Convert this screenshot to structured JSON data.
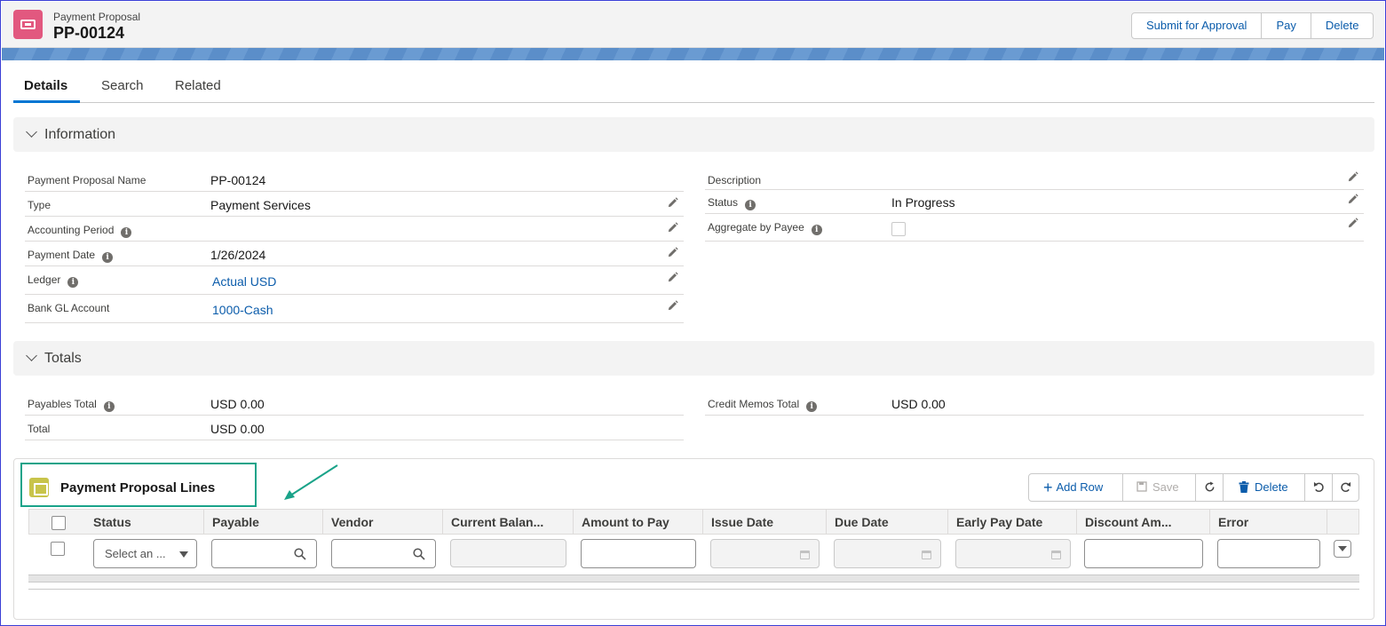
{
  "header": {
    "object_type": "Payment Proposal",
    "record_name": "PP-00124",
    "actions": [
      "Submit for Approval",
      "Pay",
      "Delete"
    ]
  },
  "tabs": [
    {
      "label": "Details",
      "active": true
    },
    {
      "label": "Search",
      "active": false
    },
    {
      "label": "Related",
      "active": false
    }
  ],
  "information": {
    "title": "Information",
    "left_fields": [
      {
        "label": "Payment Proposal Name",
        "value": "PP-00124"
      },
      {
        "label": "Type",
        "value": "Payment Services"
      },
      {
        "label": "Accounting Period",
        "value": ""
      },
      {
        "label": "Payment Date",
        "value": "1/26/2024"
      },
      {
        "label": "Ledger",
        "value": "Actual USD"
      },
      {
        "label": "Bank GL Account",
        "value": "1000-Cash"
      }
    ],
    "right_fields": [
      {
        "label": "Description",
        "value": ""
      },
      {
        "label": "Status",
        "value": "In Progress"
      },
      {
        "label": "Aggregate by Payee",
        "value": ""
      }
    ]
  },
  "totals": {
    "title": "Totals",
    "payables_total_label": "Payables Total",
    "payables_total_value": "USD 0.00",
    "total_label": "Total",
    "total_value": "USD 0.00",
    "credit_memos_label": "Credit Memos Total",
    "credit_memos_value": "USD 0.00"
  },
  "lines": {
    "title": "Payment Proposal Lines",
    "toolbar": {
      "add_row": "Add Row",
      "save": "Save",
      "delete": "Delete"
    },
    "columns": [
      "Status",
      "Payable",
      "Vendor",
      "Current Balan...",
      "Amount to Pay",
      "Issue Date",
      "Due Date",
      "Early Pay Date",
      "Discount Am...",
      "Error"
    ],
    "status_placeholder": "Select an ..."
  },
  "colors": {
    "brand_blue": "#0176d3",
    "link_blue": "#0b5cab",
    "record_icon": "#e2587f",
    "lines_icon": "#c8c44a",
    "highlight": "#1aa389"
  }
}
